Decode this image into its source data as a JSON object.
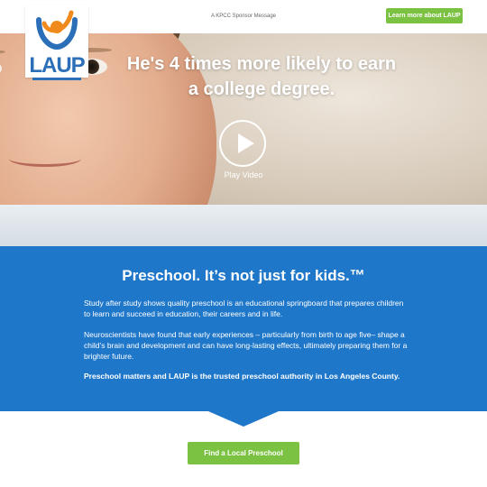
{
  "header": {
    "sponsor_text": "A KPCC Sponsor Message",
    "learn_button": "Learn more about LAUP",
    "logo_text": "LAUP"
  },
  "hero": {
    "headline_line1": "He's 4 times more likely to earn",
    "headline_line2": "a college degree.",
    "play_label": "Play Video"
  },
  "panel": {
    "title": "Preschool. It’s not just for kids.™",
    "paragraph1": "Study after study shows quality preschool is an educational springboard that prepares children to learn and succeed in education, their careers and in life.",
    "paragraph2": "Neuroscientists have found that early experiences – particularly from birth to age five– shape a child’s brain and development and can have long-lasting effects, ultimately preparing them for a brighter future.",
    "paragraph3": "Preschool matters and LAUP is the trusted preschool authority in Los Angeles County."
  },
  "cta": {
    "find_button": "Find a Local Preschool"
  },
  "colors": {
    "brand_blue": "#1f77c9",
    "accent_green": "#7cc242",
    "logo_orange": "#f08a1c"
  }
}
